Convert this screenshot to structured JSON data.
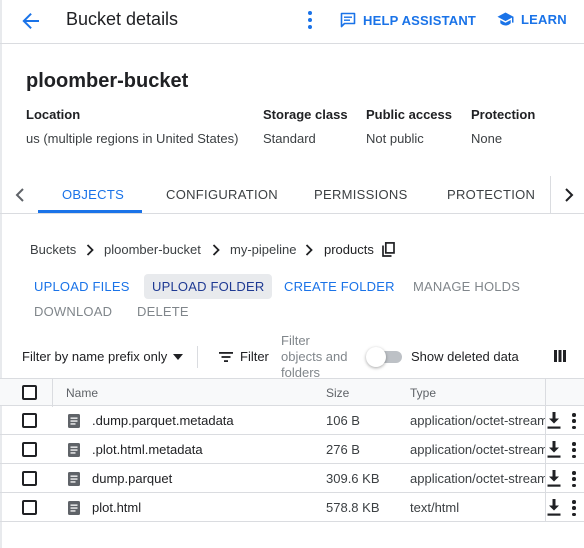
{
  "header": {
    "title": "Bucket details",
    "help_label": "HELP ASSISTANT",
    "learn_label": "LEARN"
  },
  "bucket": {
    "name": "ploomber-bucket",
    "info": [
      {
        "label": "Location",
        "value": "us (multiple regions in United States)"
      },
      {
        "label": "Storage class",
        "value": "Standard"
      },
      {
        "label": "Public access",
        "value": "Not public"
      },
      {
        "label": "Protection",
        "value": "None"
      }
    ]
  },
  "tabs": [
    {
      "label": "OBJECTS",
      "active": true
    },
    {
      "label": "CONFIGURATION",
      "active": false
    },
    {
      "label": "PERMISSIONS",
      "active": false
    },
    {
      "label": "PROTECTION",
      "active": false
    }
  ],
  "breadcrumb": [
    "Buckets",
    "ploomber-bucket",
    "my-pipeline",
    "products"
  ],
  "actions": {
    "upload_files": "UPLOAD FILES",
    "upload_folder": "UPLOAD FOLDER",
    "create_folder": "CREATE FOLDER",
    "manage_holds": "MANAGE HOLDS",
    "download": "DOWNLOAD",
    "delete": "DELETE"
  },
  "filter": {
    "prefix_label": "Filter by name prefix only",
    "filter_label": "Filter",
    "placeholder": "Filter objects and folders",
    "show_deleted_label": "Show deleted data",
    "show_deleted_on": false
  },
  "table": {
    "columns": [
      "Name",
      "Size",
      "Type"
    ],
    "rows": [
      {
        "name": ".dump.parquet.metadata",
        "size": "106 B",
        "type": "application/octet-stream"
      },
      {
        "name": ".plot.html.metadata",
        "size": "276 B",
        "type": "application/octet-stream"
      },
      {
        "name": "dump.parquet",
        "size": "309.6 KB",
        "type": "application/octet-stream"
      },
      {
        "name": "plot.html",
        "size": "578.8 KB",
        "type": "text/html"
      }
    ]
  },
  "colors": {
    "accent": "#1a73e8",
    "text": "#202124",
    "muted": "#5f6368",
    "divider": "#dadce0"
  }
}
